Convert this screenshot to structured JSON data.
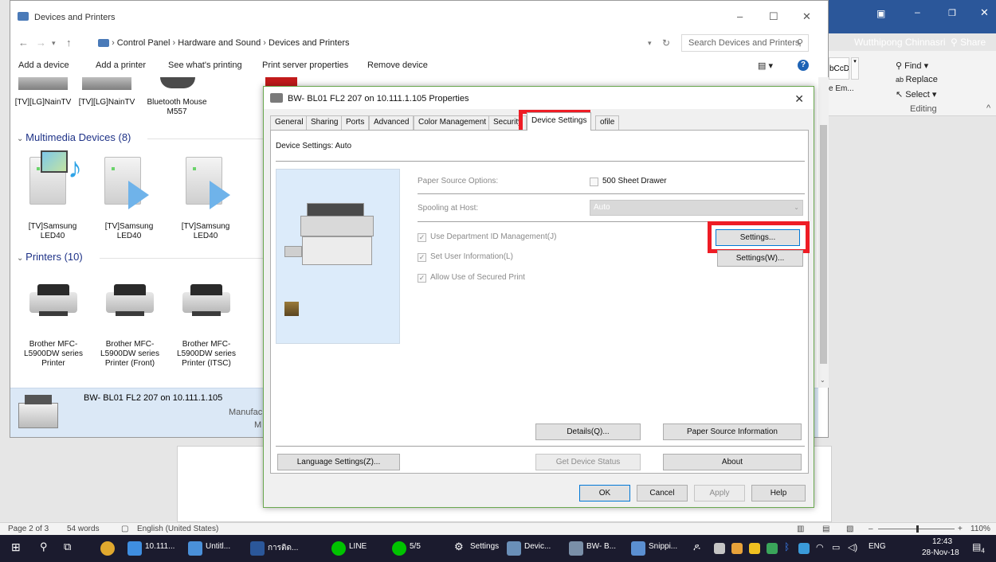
{
  "explorer": {
    "title": "Devices and Printers",
    "breadcrumb": [
      "Control Panel",
      "Hardware and Sound",
      "Devices and Printers"
    ],
    "search_placeholder": "Search Devices and Printers",
    "toolbar": [
      "Add a device",
      "Add a printer",
      "See what's printing",
      "Print server properties",
      "Remove device"
    ],
    "top_devices": [
      "[TV][LG]NainTV",
      "[TV][LG]NainTV",
      "Bluetooth Mouse M557"
    ],
    "multimedia_header": "Multimedia Devices (8)",
    "multimedia_devices": [
      "[TV]Samsung LED40",
      "[TV]Samsung LED40",
      "[TV]Samsung LED40"
    ],
    "printers_header": "Printers (10)",
    "printers": [
      "Brother MFC-L5900DW series Printer",
      "Brother MFC-L5900DW series Printer (Front)",
      "Brother MFC-L5900DW series Printer (ITSC)"
    ],
    "details_name": "BW- BL01 FL2 207 on 10.111.1.105",
    "details_manufacturer": "Manufac",
    "details_model": "M"
  },
  "dialog": {
    "title": "BW- BL01 FL2 207 on 10.111.1.105 Properties",
    "tabs": [
      "General",
      "Sharing",
      "Ports",
      "Advanced",
      "Color Management",
      "Security",
      "Device Settings",
      "ofile"
    ],
    "active_tab": "Device Settings",
    "device_settings_label": "Device Settings: Auto",
    "paper_source_label": "Paper Source Options:",
    "drawer_label": "500 Sheet Drawer",
    "spooling_label": "Spooling at Host:",
    "spooling_value": "Auto",
    "dept_id_label": "Use Department ID Management(J)",
    "user_info_label": "Set User Information(L)",
    "secured_print_label": "Allow Use of Secured Print",
    "settings_btn": "Settings...",
    "settings_w_btn": "Settings(W)...",
    "details_btn": "Details(Q)...",
    "paper_info_btn": "Paper Source Information",
    "language_btn": "Language Settings(Z)...",
    "device_status_btn": "Get Device Status",
    "about_btn": "About",
    "ok_btn": "OK",
    "cancel_btn": "Cancel",
    "apply_btn": "Apply",
    "help_btn": "Help"
  },
  "word": {
    "user": "Wutthipong Chinnasri",
    "share": "Share",
    "find": "Find",
    "replace": "Replace",
    "select": "Select",
    "editing": "Editing",
    "style_preview": "bCcDc",
    "em": "e Em...",
    "page": "Page 2 of 3",
    "words": "54 words",
    "language": "English (United States)",
    "zoom": "110%"
  },
  "taskbar": {
    "items": [
      "10.111...",
      "Untitl...",
      "การติด...",
      "LINE",
      "5/5",
      "Settings",
      "Devic...",
      "BW- B...",
      "Snippi..."
    ],
    "lang": "ENG",
    "time": "12:43",
    "date": "28-Nov-18",
    "notifications": "4"
  },
  "colors": {
    "highlight": "#ee1c25",
    "word_blue": "#2b579a",
    "section_header": "#1e3287",
    "details_bg": "#dbe8f6"
  }
}
